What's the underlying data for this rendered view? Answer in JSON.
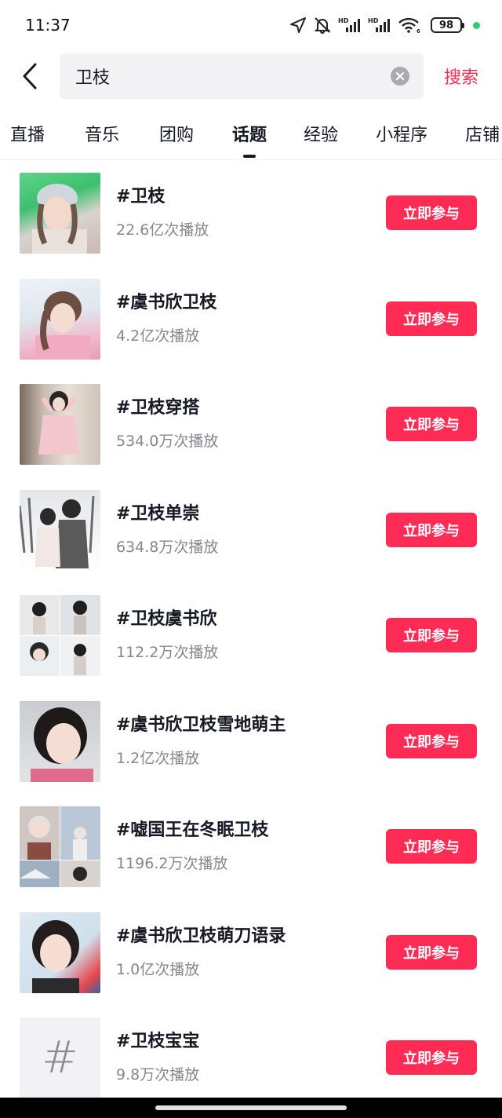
{
  "status_bar": {
    "time": "11:37",
    "battery": "98",
    "signal_labels": [
      "HD",
      "HD"
    ],
    "wifi_label": "6"
  },
  "search": {
    "query": "卫枝",
    "submit_label": "搜索"
  },
  "tabs": [
    {
      "label": "直播"
    },
    {
      "label": "音乐"
    },
    {
      "label": "团购"
    },
    {
      "label": "话题",
      "active": true
    },
    {
      "label": "经验"
    },
    {
      "label": "小程序"
    },
    {
      "label": "店铺"
    }
  ],
  "topics": [
    {
      "title": "#卫枝",
      "plays": "22.6亿次播放",
      "button": "立即参与"
    },
    {
      "title": "#虞书欣卫枝",
      "plays": "4.2亿次播放",
      "button": "立即参与"
    },
    {
      "title": "#卫枝穿搭",
      "plays": "534.0万次播放",
      "button": "立即参与"
    },
    {
      "title": "#卫枝单崇",
      "plays": "634.8万次播放",
      "button": "立即参与"
    },
    {
      "title": "#卫枝虞书欣",
      "plays": "112.2万次播放",
      "button": "立即参与"
    },
    {
      "title": "#虞书欣卫枝雪地萌主",
      "plays": "1.2亿次播放",
      "button": "立即参与"
    },
    {
      "title": "#嘘国王在冬眠卫枝",
      "plays": "1196.2万次播放",
      "button": "立即参与"
    },
    {
      "title": "#虞书欣卫枝萌刀语录",
      "plays": "1.0亿次播放",
      "button": "立即参与"
    },
    {
      "title": "#卫枝宝宝",
      "plays": "9.8万次播放",
      "button": "立即参与",
      "thumb_symbol": "#"
    }
  ],
  "colors": {
    "accent": "#fe2c55",
    "text_primary": "#161823",
    "text_secondary": "#86878c",
    "search_bg": "#f2f2f4"
  }
}
